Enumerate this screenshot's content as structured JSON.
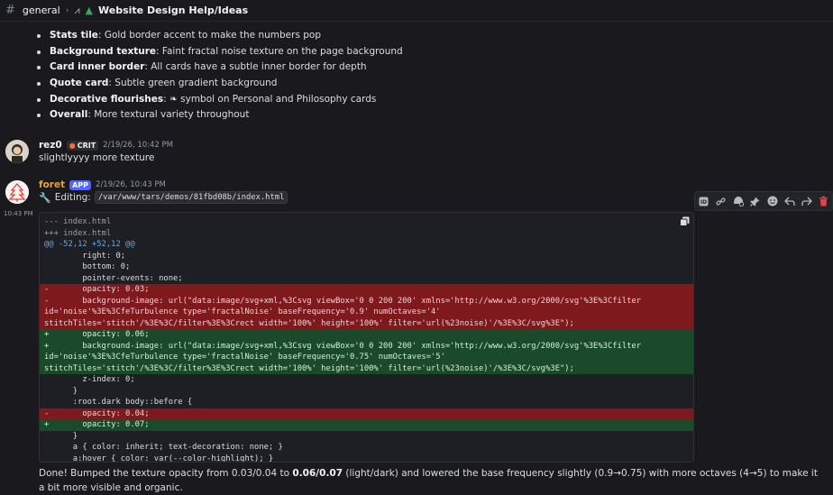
{
  "topbar": {
    "channel": "general",
    "thread_title": "Website Design Help/Ideas"
  },
  "bullets": [
    {
      "bold": "Stats tile",
      "text": ": Gold border accent to make the numbers pop"
    },
    {
      "bold": "Background texture",
      "text": ": Faint fractal noise texture on the page background"
    },
    {
      "bold": "Card inner border",
      "text": ": All cards have a subtle inner border for depth"
    },
    {
      "bold": "Quote card",
      "text": ": Subtle green gradient background"
    },
    {
      "bold": "Decorative flourishes",
      "text": ": ❧ symbol on Personal and Philosophy cards"
    },
    {
      "bold": "Overall",
      "text": ": More textural variety throughout"
    }
  ],
  "msg1": {
    "username": "rez0",
    "badge": "CRIT",
    "timestamp": "2/19/26, 10:42 PM",
    "text": "slightlyyyy more texture",
    "username_color": "#f2f3f5"
  },
  "msg2": {
    "username": "foret",
    "badge": "APP",
    "timestamp": "2/19/26, 10:43 PM",
    "side_time": "10:43 PM",
    "username_color": "#e8a040",
    "editing_label": "Editing:",
    "editing_path": "/var/www/tars/demos/81fbd08b/index.html"
  },
  "toolbar": {
    "icons": [
      "app-icon",
      "link-icon",
      "thread-icon",
      "pin-icon",
      "emoji-icon",
      "reply-icon",
      "forward-icon",
      "delete-icon"
    ]
  },
  "diff": {
    "lines": [
      {
        "type": "meta",
        "text": "--- index.html"
      },
      {
        "type": "meta",
        "text": "+++ index.html"
      },
      {
        "type": "hunk",
        "text": "@@ -52,12 +52,12 @@"
      },
      {
        "type": "ctx",
        "text": "        right: 0;"
      },
      {
        "type": "ctx",
        "text": "        bottom: 0;"
      },
      {
        "type": "ctx",
        "text": "        pointer-events: none;"
      },
      {
        "type": "del",
        "text": "-       opacity: 0.03;"
      },
      {
        "type": "del",
        "text": "-       background-image: url(\"data:image/svg+xml,%3Csvg viewBox='0 0 200 200' xmlns='http://www.w3.org/2000/svg'%3E%3Cfilter"
      },
      {
        "type": "del",
        "text": "id='noise'%3E%3CfeTurbulence type='fractalNoise' baseFrequency='0.9' numOctaves='4'"
      },
      {
        "type": "del",
        "text": "stitchTiles='stitch'/%3E%3C/filter%3E%3Crect width='100%' height='100%' filter='url(%23noise)'/%3E%3C/svg%3E\");"
      },
      {
        "type": "add",
        "text": "+       opacity: 0.06;"
      },
      {
        "type": "add",
        "text": "+       background-image: url(\"data:image/svg+xml,%3Csvg viewBox='0 0 200 200' xmlns='http://www.w3.org/2000/svg'%3E%3Cfilter"
      },
      {
        "type": "add",
        "text": "id='noise'%3E%3CfeTurbulence type='fractalNoise' baseFrequency='0.75' numOctaves='5'"
      },
      {
        "type": "add",
        "text": "stitchTiles='stitch'/%3E%3C/filter%3E%3Crect width='100%' height='100%' filter='url(%23noise)'/%3E%3C/svg%3E\");"
      },
      {
        "type": "ctx",
        "text": "        z-index: 0;"
      },
      {
        "type": "ctx",
        "text": "      }"
      },
      {
        "type": "ctx",
        "text": "      :root.dark body::before {"
      },
      {
        "type": "del",
        "text": "-       opacity: 0.04;"
      },
      {
        "type": "add",
        "text": "+       opacity: 0.07;"
      },
      {
        "type": "ctx",
        "text": "      }"
      },
      {
        "type": "ctx",
        "text": "      a { color: inherit; text-decoration: none; }"
      },
      {
        "type": "ctx",
        "text": "      a:hover { color: var(--color-highlight); }"
      }
    ]
  },
  "final": {
    "p1": "Done! Bumped the texture opacity from 0.03/0.04 to ",
    "b1": "0.06/0.07",
    "p2": " (light/dark) and lowered the base frequency slightly (0.9→0.75) with more octaves (4→5) to make it a bit more visible and organic."
  }
}
